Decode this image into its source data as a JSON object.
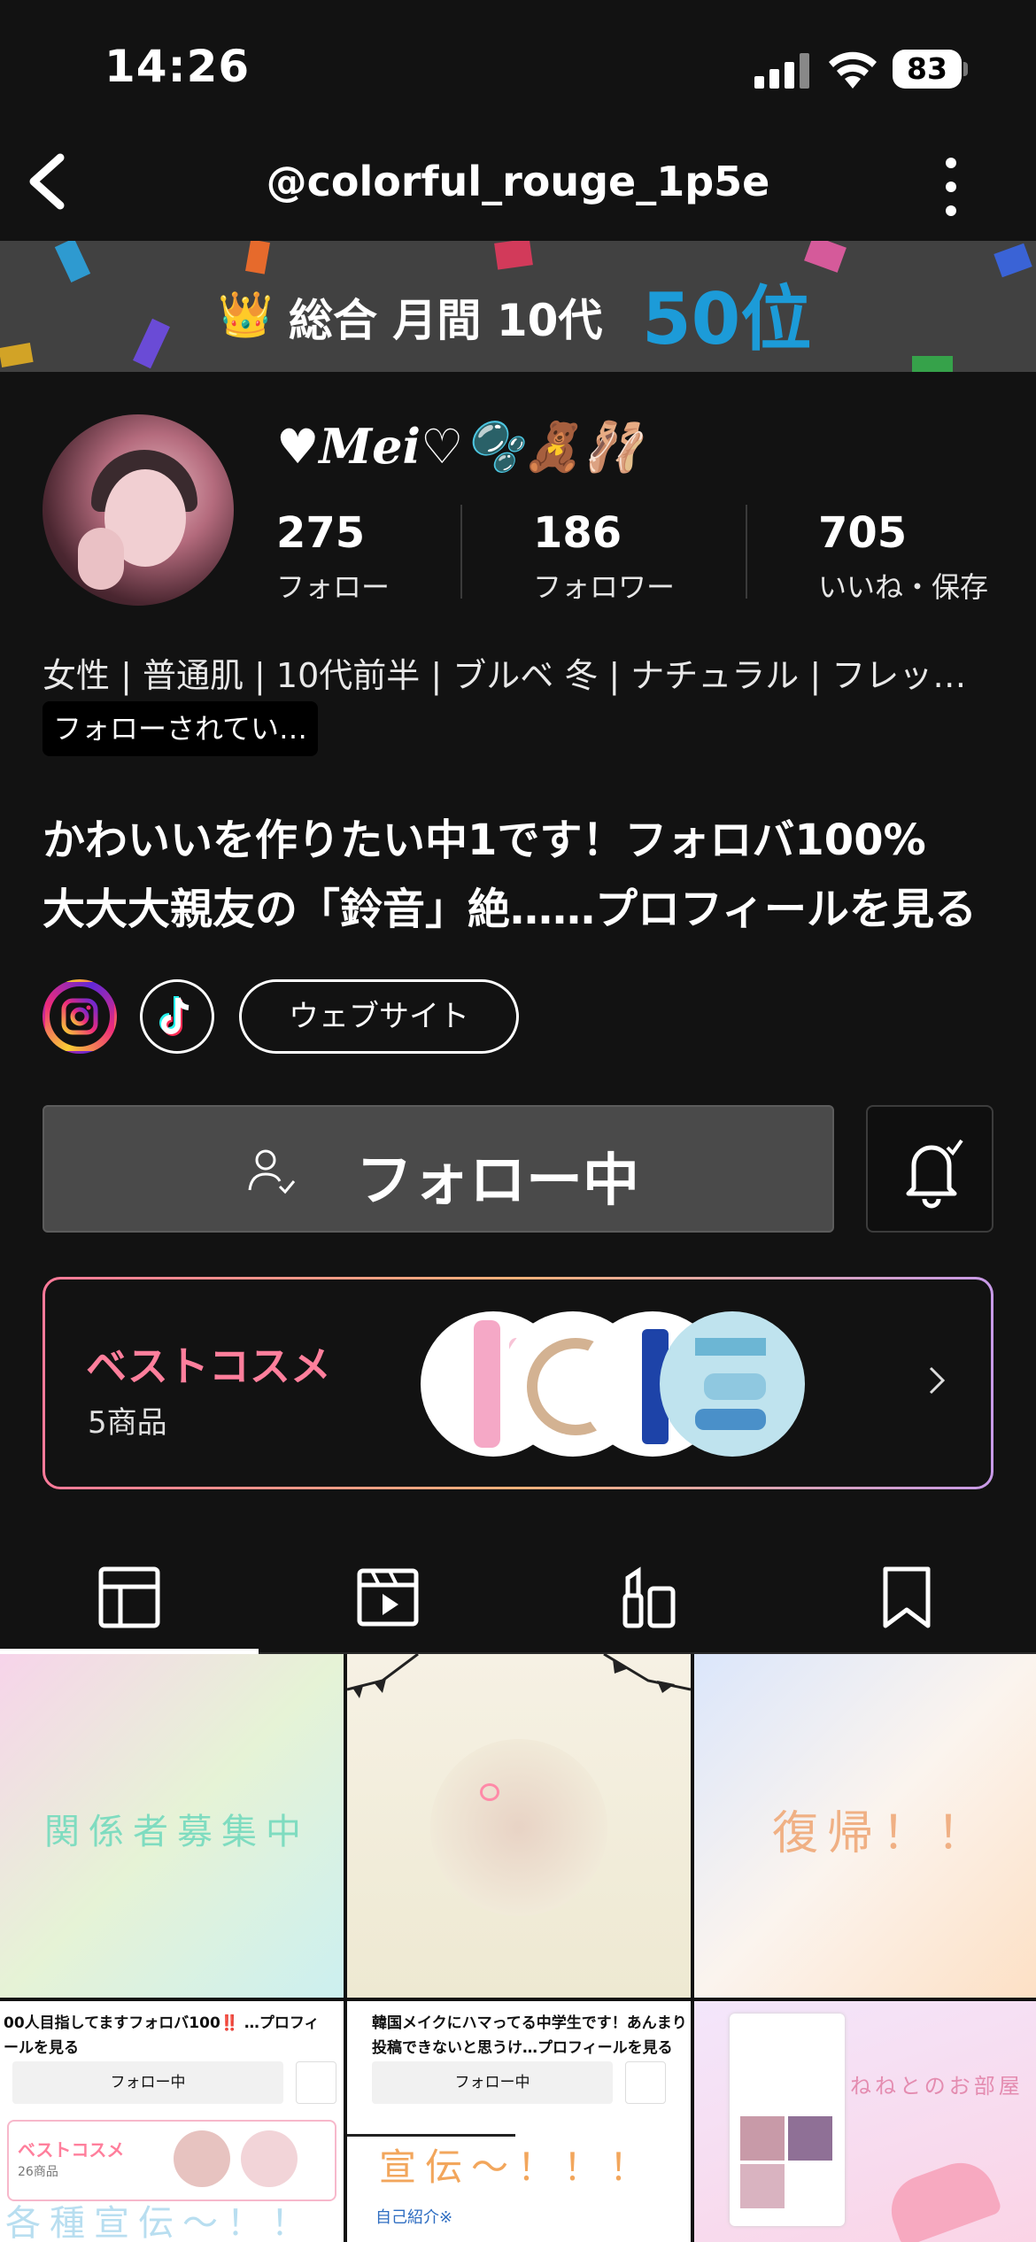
{
  "status_bar": {
    "time": "14:26",
    "battery": "83"
  },
  "header": {
    "username": "@colorful_rouge_1p5e"
  },
  "banner": {
    "crown": "👑",
    "rank_label": "総合 月間 10代",
    "rank_position": "50位"
  },
  "profile": {
    "display_name": "♥𝑴𝒆𝒊♡🫧🧸🩰",
    "stats": [
      {
        "value": "275",
        "label": "フォロー"
      },
      {
        "value": "186",
        "label": "フォロワー"
      },
      {
        "value": "705",
        "label": "いいね・保存"
      }
    ],
    "attributes": "女性 | 普通肌 | 10代前半 | ブルベ 冬 | ナチュラル | フレッ…",
    "followed_badge": "フォローされてい…",
    "bio_line1": "かわいいを作りたい中1です！フォロバ100%",
    "bio_line2": "大大大親友の「鈴音」絶…",
    "bio_more": "…プロフィールを見る"
  },
  "links": {
    "website": "ウェブサイト"
  },
  "actions": {
    "follow_label": "フォロー中"
  },
  "best_cosme": {
    "title": "ベストコスメ",
    "count": "5商品"
  },
  "grid": {
    "posts": [
      {
        "text": "関係者募集中"
      },
      {
        "text": ""
      },
      {
        "text": "復帰！！"
      },
      {
        "bio": "00人目指してますフォロバ100‼️ …プロフィ",
        "bio2": "ールを見る",
        "follow": "フォロー中",
        "best": "ベストコスメ",
        "best_count": "26商品",
        "overlay": "各種宣伝〜！！"
      },
      {
        "bio": "韓国メイクにハマってる中学生です！あんまり",
        "bio2": "投稿できないと思うけ…プロフィールを見る",
        "follow": "フォロー中",
        "overlay": "宣伝〜！！！",
        "tag": "自己紹介※"
      },
      {
        "text": "ねねとのお部屋"
      }
    ]
  },
  "colors": {
    "accent_blue": "#1c9bd8",
    "best_pink": "#ff7f9c",
    "banner_bg": "#414141"
  }
}
